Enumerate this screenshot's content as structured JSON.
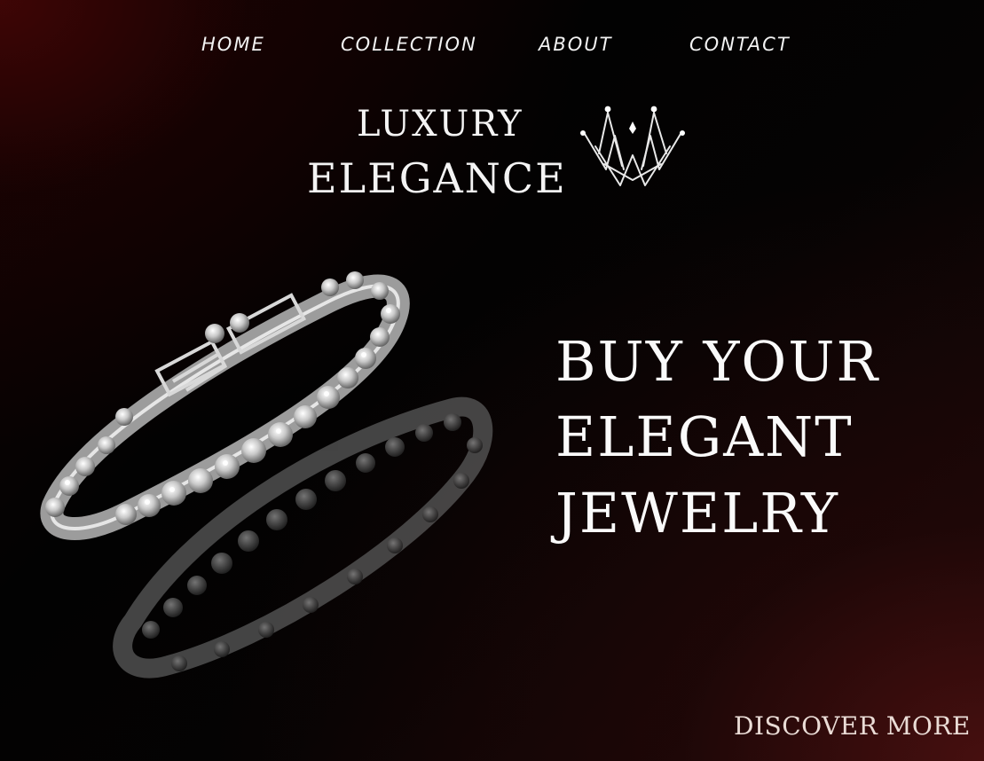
{
  "nav": {
    "items": [
      {
        "label": "HOME"
      },
      {
        "label": "COLLECTION"
      },
      {
        "label": "ABOUT"
      },
      {
        "label": "CONTACT"
      }
    ]
  },
  "logo": {
    "line1": "LUXURY",
    "line2": "ELEGANCE",
    "icon": "crown-icon"
  },
  "hero": {
    "headline": [
      "BUY YOUR",
      "ELEGANT",
      "JEWELRY"
    ],
    "image": "diamond-bracelet-image"
  },
  "cta": {
    "label": "DISCOVER MORE"
  },
  "colors": {
    "background": "#050303",
    "accent_red": "#4b1010",
    "text": "#ffffff",
    "cta_text": "#eadcd6"
  }
}
